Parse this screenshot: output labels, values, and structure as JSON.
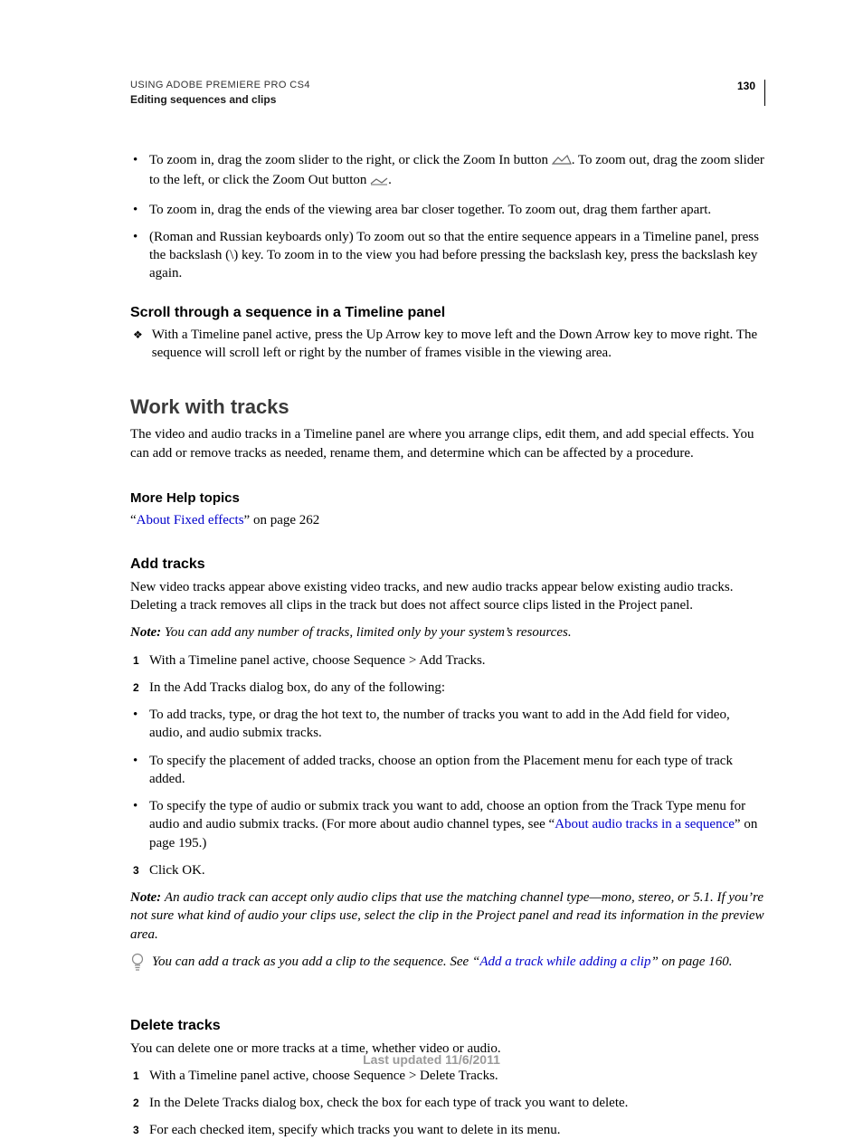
{
  "header": {
    "line1": "USING ADOBE PREMIERE PRO CS4",
    "line2": "Editing sequences and clips",
    "page": "130"
  },
  "zoom": {
    "b1a": "To zoom in, drag the zoom slider to the right, or click the Zoom In button ",
    "b1b": ". To zoom out, drag the zoom slider to the left, or click the Zoom Out button ",
    "b1c": ".",
    "b2": "To zoom in, drag the ends of the viewing area bar closer together. To zoom out, drag them farther apart.",
    "b3": "(Roman and Russian keyboards only) To zoom out so that the entire sequence appears in a Timeline panel, press the backslash (\\) key. To zoom in to the view you had before pressing the backslash key, press the backslash key again."
  },
  "scroll": {
    "heading": "Scroll through a sequence in a Timeline panel",
    "body": "With a Timeline panel active, press the Up Arrow key to move left and the Down Arrow key to move right. The sequence will scroll left or right by the number of frames visible in the viewing area."
  },
  "tracks": {
    "heading": "Work with tracks",
    "intro": "The video and audio tracks in a Timeline panel are where you arrange clips, edit them, and add special effects. You can add or remove tracks as needed, rename them, and determine which can be affected by a procedure.",
    "moreHelp": "More Help topics",
    "help_q1": "“",
    "help_link": "About Fixed effects",
    "help_tail": "” on page 262"
  },
  "add": {
    "heading": "Add tracks",
    "p1": "New video tracks appear above existing video tracks, and new audio tracks appear below existing audio tracks. Deleting a track removes all clips in the track but does not affect source clips listed in the Project panel.",
    "noteLabel": "Note: ",
    "note1": "You can add any number of tracks, limited only by your system’s resources.",
    "s1": "With a Timeline panel active, choose Sequence > Add Tracks.",
    "s2": "In the Add Tracks dialog box, do any of the following:",
    "sb1": "To add tracks, type, or drag the hot text to, the number of tracks you want to add in the Add field for video, audio, and audio submix tracks.",
    "sb2": "To specify the placement of added tracks, choose an option from the Placement menu for each type of track added.",
    "sb3a": "To specify the type of audio or submix track you want to add, choose an option from the Track Type menu for audio and audio submix tracks. (For more about audio channel types, see “",
    "sb3link": "About audio tracks in a sequence",
    "sb3b": "” on page 195.)",
    "s3": "Click OK.",
    "note2": "An audio track can accept only audio clips that use the matching channel type—mono, stereo, or 5.1. If you’re not sure what kind of audio your clips use, select the clip in the Project panel and read its information in the preview area.",
    "tipA": "You can add a track as you add a clip to the sequence. See “",
    "tipLink": "Add a track while adding a clip",
    "tipB": "” on page 160."
  },
  "del": {
    "heading": "Delete tracks",
    "p1": "You can delete one or more tracks at a time, whether video or audio.",
    "s1": "With a Timeline panel active, choose Sequence > Delete Tracks.",
    "s2": "In the Delete Tracks dialog box, check the box for each type of track you want to delete.",
    "s3": "For each checked item, specify which tracks you want to delete in its menu."
  },
  "footer": "Last updated 11/6/2011",
  "num": {
    "n1": "1",
    "n2": "2",
    "n3": "3"
  }
}
